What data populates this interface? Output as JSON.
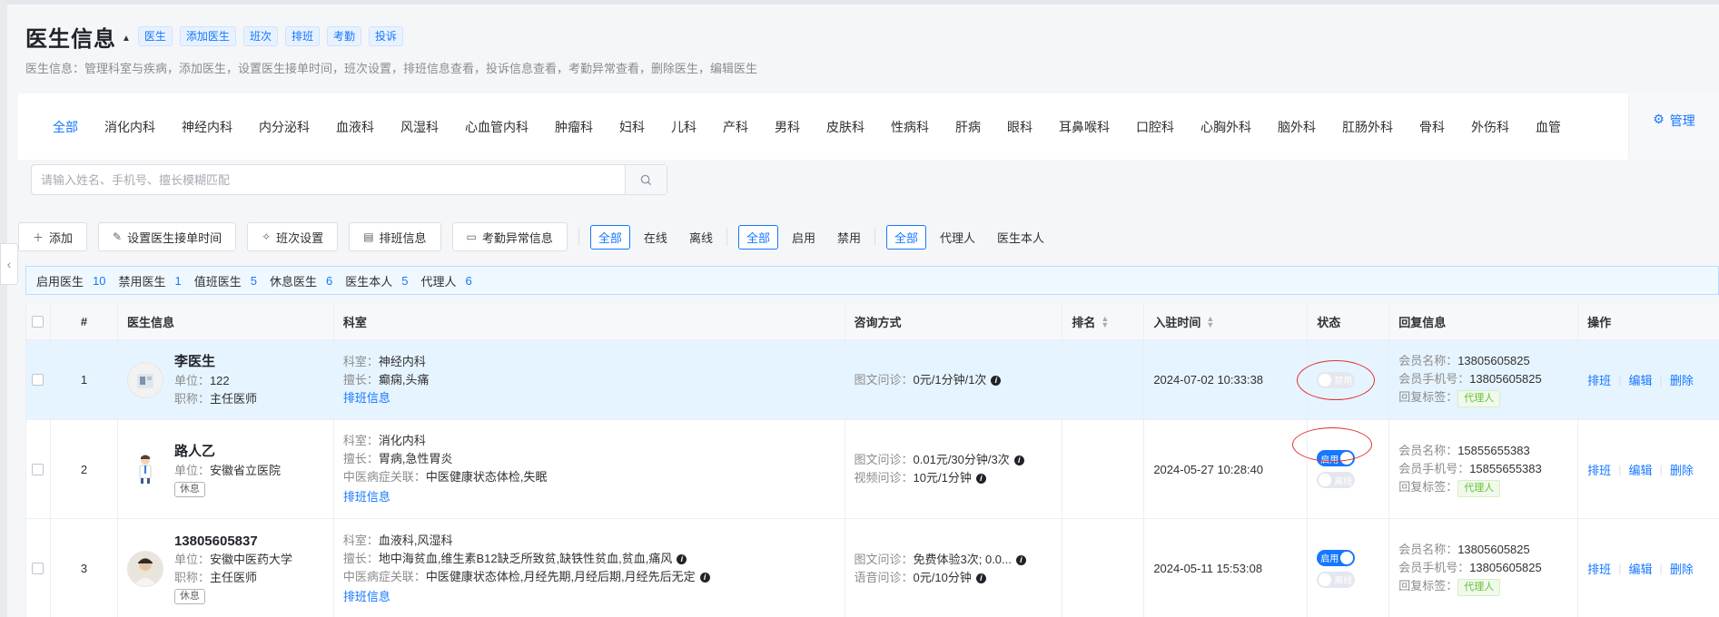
{
  "header": {
    "title": "医生信息",
    "tags": [
      "医生",
      "添加医生",
      "班次",
      "排班",
      "考勤",
      "投诉"
    ],
    "description": "医生信息：管理科室与疾病，添加医生，设置医生接单时间，班次设置，排班信息查看，投诉信息查看，考勤异常查看，删除医生，编辑医生"
  },
  "departments": [
    "全部",
    "消化内科",
    "神经内科",
    "内分泌科",
    "血液科",
    "风湿科",
    "心血管内科",
    "肿瘤科",
    "妇科",
    "儿科",
    "产科",
    "男科",
    "皮肤科",
    "性病科",
    "肝病",
    "眼科",
    "耳鼻喉科",
    "口腔科",
    "心胸外科",
    "脑外科",
    "肛肠外科",
    "骨科",
    "外伤科",
    "血管"
  ],
  "manage_label": "管理",
  "search": {
    "placeholder": "请输入姓名、手机号、擅长模糊匹配"
  },
  "toolbar": {
    "add": "添加",
    "set_time": "设置医生接单时间",
    "shift": "班次设置",
    "schedule": "排班信息",
    "attendance": "考勤异常信息",
    "filter_online": [
      "全部",
      "在线",
      "离线"
    ],
    "filter_enable": [
      "全部",
      "启用",
      "禁用"
    ],
    "filter_agent": [
      "全部",
      "代理人",
      "医生本人"
    ]
  },
  "stats": [
    {
      "label": "启用医生",
      "value": "10"
    },
    {
      "label": "禁用医生",
      "value": "1"
    },
    {
      "label": "值班医生",
      "value": "5"
    },
    {
      "label": "休息医生",
      "value": "6"
    },
    {
      "label": "医生本人",
      "value": "5"
    },
    {
      "label": "代理人",
      "value": "6"
    }
  ],
  "table": {
    "headers": [
      "#",
      "医生信息",
      "科室",
      "咨询方式",
      "排名",
      "入驻时间",
      "状态",
      "回复信息",
      "操作"
    ],
    "rows": [
      {
        "index": "1",
        "name": "李医生",
        "unit_label": "单位：",
        "unit": "122",
        "title_label": "职称：",
        "title": "主任医师",
        "rest_tag": "",
        "dept_label": "科室：",
        "dept": "神经内科",
        "good_label": "擅长：",
        "good": "癫痫,头痛",
        "tcm_label": "",
        "tcm": "",
        "schedule_link": "排班信息",
        "consult": [
          {
            "label": "图文问诊：",
            "value": "0元/1分钟/1次"
          }
        ],
        "join_time": "2024-07-02 10:33:38",
        "status_enable": "禁用",
        "status_online": "",
        "member_name_label": "会员名称：",
        "member_name": "13805605825",
        "member_phone_label": "会员手机号：",
        "member_phone": "13805605825",
        "reply_tag_label": "回复标签：",
        "reply_tag": "代理人"
      },
      {
        "index": "2",
        "name": "路人乙",
        "unit_label": "单位：",
        "unit": "安徽省立医院",
        "title_label": "",
        "title": "",
        "rest_tag": "休息",
        "dept_label": "科室：",
        "dept": "消化内科",
        "good_label": "擅长：",
        "good": "胃病,急性胃炎",
        "tcm_label": "中医病症关联：",
        "tcm": "中医健康状态体检,失眠",
        "schedule_link": "排班信息",
        "consult": [
          {
            "label": "图文问诊：",
            "value": "0.01元/30分钟/3次"
          },
          {
            "label": "视频问诊：",
            "value": "10元/1分钟"
          }
        ],
        "join_time": "2024-05-27 10:28:40",
        "status_enable": "启用",
        "status_online": "离线",
        "member_name_label": "会员名称：",
        "member_name": "15855655383",
        "member_phone_label": "会员手机号：",
        "member_phone": "15855655383",
        "reply_tag_label": "回复标签：",
        "reply_tag": "代理人"
      },
      {
        "index": "3",
        "name": "13805605837",
        "unit_label": "单位：",
        "unit": "安徽中医药大学",
        "title_label": "职称：",
        "title": "主任医师",
        "rest_tag": "休息",
        "dept_label": "科室：",
        "dept": "血液科,风湿科",
        "good_label": "擅长：",
        "good": "地中海贫血,维生素B12缺乏所致贫,缺铁性贫血,贫血,痛风",
        "tcm_label": "中医病症关联：",
        "tcm": "中医健康状态体检,月经先期,月经后期,月经先后无定",
        "schedule_link": "排班信息",
        "consult": [
          {
            "label": "图文问诊：",
            "value": "免费体验3次; 0.0..."
          },
          {
            "label": "语音问诊：",
            "value": "0元/10分钟"
          }
        ],
        "join_time": "2024-05-11 15:53:08",
        "status_enable": "启用",
        "status_online": "离线",
        "member_name_label": "会员名称：",
        "member_name": "13805605825",
        "member_phone_label": "会员手机号：",
        "member_phone": "13805605825",
        "reply_tag_label": "回复标签：",
        "reply_tag": "代理人"
      }
    ],
    "ops": [
      "排班",
      "编辑",
      "删除"
    ]
  },
  "colors": {
    "accent": "#1677ff",
    "selected_row": "#e6f4ff",
    "highlight": "#e03131"
  }
}
